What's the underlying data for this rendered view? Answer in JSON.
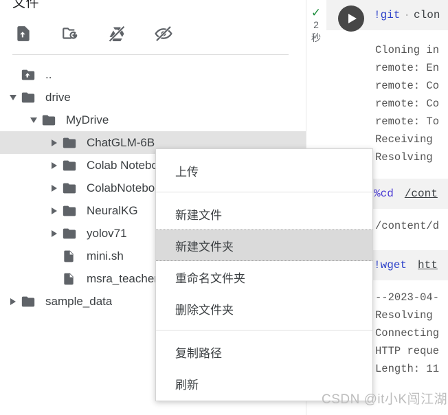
{
  "files_panel": {
    "title": "文件",
    "toolbar": [
      {
        "name": "upload-icon",
        "tooltip": "上传"
      },
      {
        "name": "refresh-folder-icon",
        "tooltip": "刷新"
      },
      {
        "name": "mount-drive-off-icon",
        "tooltip": "装载云端硬盘"
      },
      {
        "name": "hide-hidden-files-icon",
        "tooltip": "隐藏"
      }
    ],
    "tree": [
      {
        "label": "..",
        "type": "parent",
        "indent": 0,
        "twisty": "none",
        "selected": false
      },
      {
        "label": "drive",
        "type": "folder",
        "indent": 0,
        "twisty": "open",
        "selected": false
      },
      {
        "label": "MyDrive",
        "type": "folder",
        "indent": 1,
        "twisty": "open",
        "selected": false
      },
      {
        "label": "ChatGLM-6B",
        "type": "folder",
        "indent": 2,
        "twisty": "closed",
        "selected": true
      },
      {
        "label": "Colab Notebooks",
        "type": "folder",
        "indent": 2,
        "twisty": "closed",
        "selected": false
      },
      {
        "label": "ColabNotebooks",
        "type": "folder",
        "indent": 2,
        "twisty": "closed",
        "selected": false
      },
      {
        "label": "NeuralKG",
        "type": "folder",
        "indent": 2,
        "twisty": "closed",
        "selected": false
      },
      {
        "label": "yolov71",
        "type": "folder",
        "indent": 2,
        "twisty": "closed",
        "selected": false
      },
      {
        "label": "mini.sh",
        "type": "file",
        "indent": 2,
        "twisty": "none",
        "selected": false
      },
      {
        "label": "msra_teacher",
        "type": "file",
        "indent": 2,
        "twisty": "none",
        "selected": false
      },
      {
        "label": "sample_data",
        "type": "folder",
        "indent": 0,
        "twisty": "closed",
        "selected": false
      }
    ]
  },
  "context_menu": {
    "items": [
      {
        "label": "上传",
        "hover": false,
        "sep_after": true
      },
      {
        "label": "新建文件",
        "hover": false,
        "sep_after": false
      },
      {
        "label": "新建文件夹",
        "hover": true,
        "sep_after": false
      },
      {
        "label": "重命名文件夹",
        "hover": false,
        "sep_after": false
      },
      {
        "label": "删除文件夹",
        "hover": false,
        "sep_after": true
      },
      {
        "label": "复制路径",
        "hover": false,
        "sep_after": false
      },
      {
        "label": "刷新",
        "hover": false,
        "sep_after": false
      }
    ]
  },
  "notebook": {
    "cell1": {
      "status_check": "✓",
      "duration_value": "2",
      "duration_unit": "秒",
      "code_bang": "!git",
      "code_space_dot": "·",
      "code_rest": "clon",
      "output": [
        "Cloning in",
        "remote: En",
        "remote: Co",
        "remote: Co",
        "remote: To",
        "Receiving",
        "Resolving"
      ]
    },
    "cell2": {
      "code_magic": "%cd",
      "code_path": "/cont",
      "output": [
        "/content/d"
      ]
    },
    "cell3": {
      "code_bang": "!wget",
      "code_url": "htt",
      "output": [
        "--2023-04-",
        "Resolving",
        "Connecting",
        "HTTP reque",
        "Length: 11"
      ]
    }
  },
  "watermark": {
    "text": "CSDN @it小K闯江湖"
  },
  "colors": {
    "selection": "#e2e2e2",
    "menu_hover": "#dadada",
    "icon": "#5f6368",
    "success": "#1e8e3e",
    "run_button": "#474747",
    "code_blue": "#2d41c9",
    "code_purple": "#4b3bd4",
    "watermark": "#bdbdbd"
  }
}
